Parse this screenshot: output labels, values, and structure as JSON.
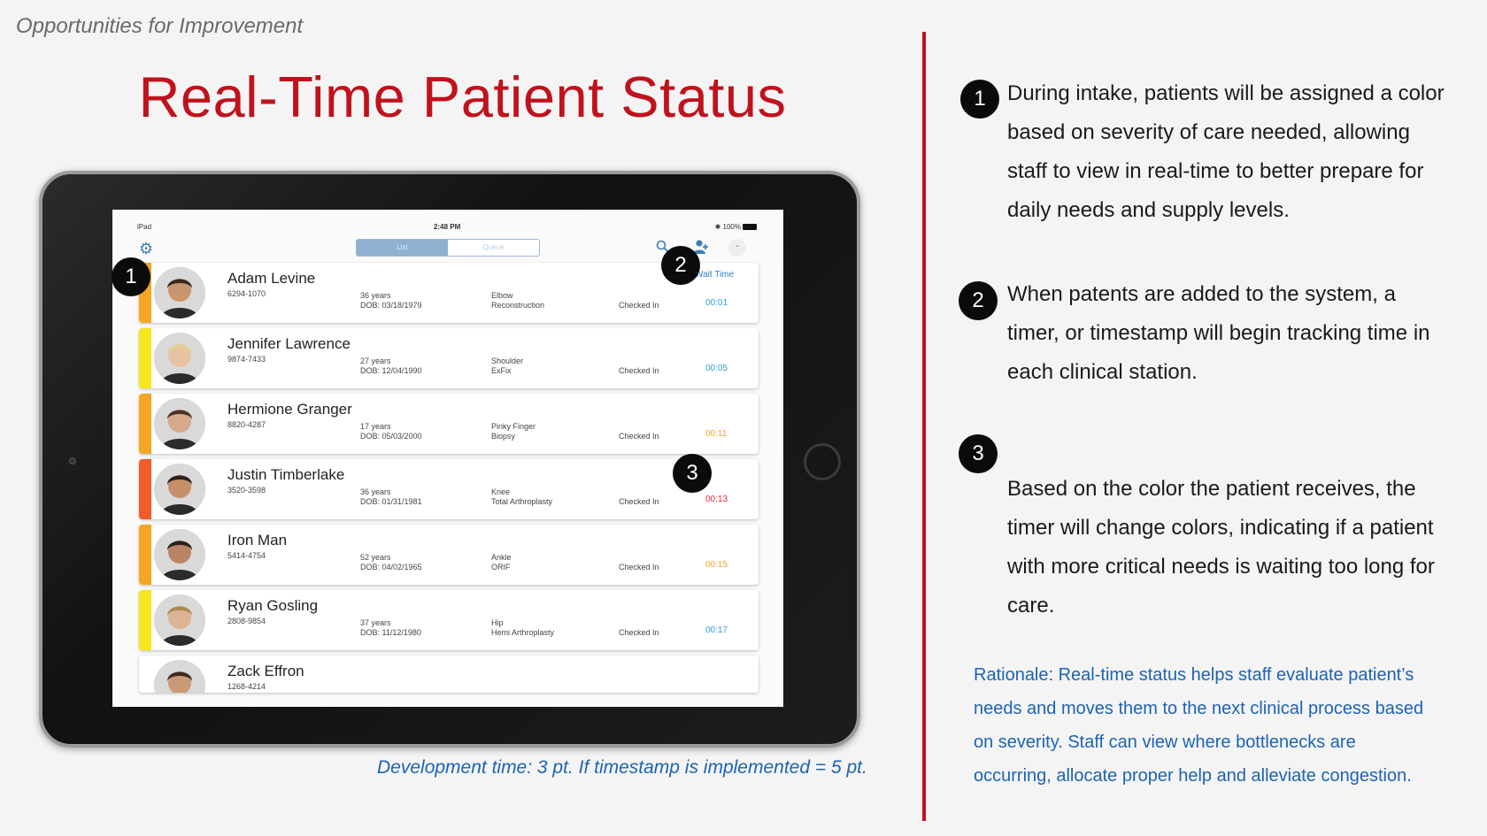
{
  "slide": {
    "section_label": "Opportunities for Improvement",
    "title": "Real-Time Patient Status",
    "dev_time": "Development time: 3 pt. If timestamp is implemented = 5 pt.",
    "accent_color": "#c0121d",
    "link_color": "#1d63b3"
  },
  "ipad": {
    "statusbar": {
      "carrier": "iPad",
      "clock": "2:48 PM",
      "battery": "100%"
    },
    "navbar": {
      "settings_icon": "gear-icon",
      "segments": [
        "List",
        "Queue"
      ],
      "search_icon": "search-icon",
      "add_user_icon": "add-user-icon",
      "more_label": "-"
    },
    "wait_time_label": "Wait Time",
    "patients": [
      {
        "name": "Adam Levine",
        "id": "6294-1070",
        "age": "36 years",
        "dob": "DOB: 03/18/1979",
        "proc1": "Elbow",
        "proc2": "Reconstruction",
        "status": "Checked In",
        "timer": "00:01",
        "severity_color": "#f5a623",
        "timer_color": "#2f9fd8"
      },
      {
        "name": "Jennifer Lawrence",
        "id": "9874-7433",
        "age": "27 years",
        "dob": "DOB: 12/04/1990",
        "proc1": "Shoulder",
        "proc2": "ExFix",
        "status": "Checked In",
        "timer": "00:05",
        "severity_color": "#f5e71c",
        "timer_color": "#2f9fd8"
      },
      {
        "name": "Hermione Granger",
        "id": "8820-4287",
        "age": "17 years",
        "dob": "DOB: 05/03/2000",
        "proc1": "Pinky Finger",
        "proc2": "Biopsy",
        "status": "Checked In",
        "timer": "00:11",
        "severity_color": "#f5a623",
        "timer_color": "#f5a623"
      },
      {
        "name": "Justin Timberlake",
        "id": "3520-3598",
        "age": "36 years",
        "dob": "DOB: 01/31/1981",
        "proc1": "Knee",
        "proc2": "Total Arthroplasty",
        "status": "Checked In",
        "timer": "00:13",
        "severity_color": "#f25c2a",
        "timer_color": "#e8262b"
      },
      {
        "name": "Iron Man",
        "id": "5414-4754",
        "age": "52 years",
        "dob": "DOB: 04/02/1965",
        "proc1": "Ankle",
        "proc2": "ORIF",
        "status": "Checked In",
        "timer": "00:15",
        "severity_color": "#f5a623",
        "timer_color": "#f5a623"
      },
      {
        "name": "Ryan Gosling",
        "id": "2808-9854",
        "age": "37 years",
        "dob": "DOB: 11/12/1980",
        "proc1": "Hip",
        "proc2": "Hemi Arthroplasty",
        "status": "Checked In",
        "timer": "00:17",
        "severity_color": "#f5e71c",
        "timer_color": "#2f9fd8"
      },
      {
        "name": "Zack Effron",
        "id": "1268-4214",
        "age": "",
        "dob": "",
        "proc1": "",
        "proc2": "",
        "status": "",
        "timer": "",
        "severity_color": "#ffffff",
        "timer_color": "#2f9fd8"
      }
    ]
  },
  "markers": [
    "1",
    "2",
    "3"
  ],
  "notes": {
    "n1": [
      "During intake, patients will be assigned a color",
      "based on severity of care needed, allowing",
      "staff to view in real-time to better prepare for",
      "daily needs and supply levels."
    ],
    "n2": [
      "When patents are added to the system, a",
      "timer, or timestamp will begin tracking time in",
      "each clinical station."
    ],
    "n3": [
      "Based on the color the patient receives, the",
      "timer will change colors, indicating if a patient",
      "with more critical needs is waiting too long for",
      "care."
    ]
  },
  "rationale": [
    "Rationale: Real-time status helps staff evaluate patient’s",
    "needs and moves them to the next clinical process based",
    "on severity.  Staff can view where bottlenecks are",
    "occurring, allocate proper help and alleviate congestion."
  ]
}
